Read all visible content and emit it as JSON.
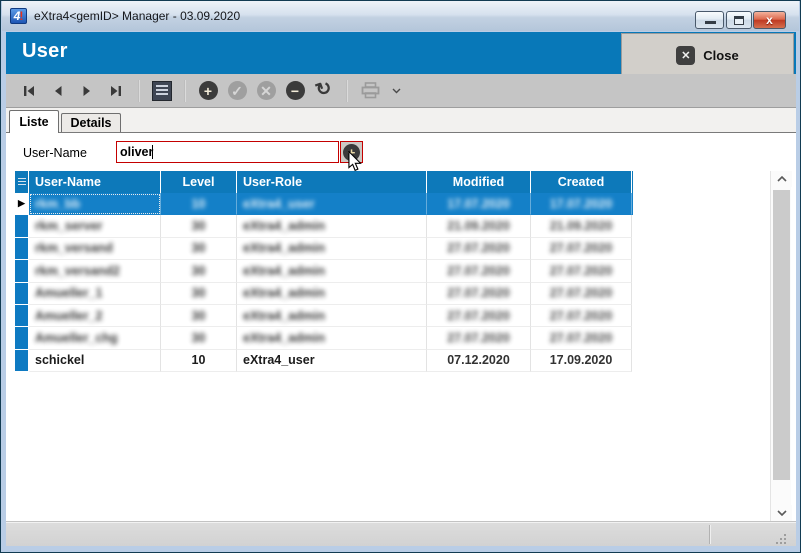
{
  "window": {
    "title": "eXtra4<gemID> Manager - 03.09.2020",
    "app_icon_text": "4",
    "app_icon_excl": "!",
    "controls": {
      "minimize": "minimize",
      "maximize": "maximize",
      "close": "close"
    }
  },
  "header": {
    "title": "User",
    "close_button": {
      "label": "Close",
      "glyph": "✕"
    }
  },
  "toolbar": {
    "items": [
      {
        "name": "first-record-button"
      },
      {
        "name": "prior-record-button"
      },
      {
        "name": "next-record-button"
      },
      {
        "name": "last-record-button"
      },
      {
        "name": "form-view-button"
      },
      {
        "name": "insert-record-button",
        "glyph": "+",
        "enabled": true
      },
      {
        "name": "confirm-button",
        "glyph": "✓",
        "enabled": false
      },
      {
        "name": "cancel-button",
        "glyph": "✕",
        "enabled": false
      },
      {
        "name": "delete-record-button",
        "glyph": "−",
        "enabled": true
      },
      {
        "name": "refresh-button",
        "glyph": "↻",
        "enabled": true
      },
      {
        "name": "print-button",
        "enabled": false
      },
      {
        "name": "print-dropdown-button"
      }
    ]
  },
  "tabs": [
    {
      "label": "Liste",
      "active": true
    },
    {
      "label": "Details",
      "active": false
    }
  ],
  "filter": {
    "label": "User-Name",
    "value": "oliver",
    "add_button_glyph": "+"
  },
  "table": {
    "columns": [
      "User-Name",
      "Level",
      "User-Role",
      "Modified",
      "Created"
    ],
    "rows": [
      {
        "user_name": "rkm_bb",
        "level": "10",
        "user_role": "eXtra4_user",
        "modified": "17.07.2020",
        "created": "17.07.2020",
        "selected": true,
        "blurred": true
      },
      {
        "user_name": "rkm_server",
        "level": "30",
        "user_role": "eXtra4_admin",
        "modified": "21.09.2020",
        "created": "21.09.2020",
        "selected": false,
        "blurred": true
      },
      {
        "user_name": "rkm_versand",
        "level": "30",
        "user_role": "eXtra4_admin",
        "modified": "27.07.2020",
        "created": "27.07.2020",
        "selected": false,
        "blurred": true
      },
      {
        "user_name": "rkm_versand2",
        "level": "30",
        "user_role": "eXtra4_admin",
        "modified": "27.07.2020",
        "created": "27.07.2020",
        "selected": false,
        "blurred": true
      },
      {
        "user_name": "Amueller_1",
        "level": "30",
        "user_role": "eXtra4_admin",
        "modified": "27.07.2020",
        "created": "27.07.2020",
        "selected": false,
        "blurred": true
      },
      {
        "user_name": "Amueller_2",
        "level": "30",
        "user_role": "eXtra4_admin",
        "modified": "27.07.2020",
        "created": "27.07.2020",
        "selected": false,
        "blurred": true
      },
      {
        "user_name": "Amueller_chg",
        "level": "30",
        "user_role": "eXtra4_admin",
        "modified": "27.07.2020",
        "created": "27.07.2020",
        "selected": false,
        "blurred": true
      },
      {
        "user_name": "schickel",
        "level": "10",
        "user_role": "eXtra4_user",
        "modified": "07.12.2020",
        "created": "17.09.2020",
        "selected": false,
        "blurred": false
      }
    ]
  },
  "colors": {
    "accent_blue": "#0878b8",
    "header_blue": "#0d79ba",
    "selection_blue": "#1480c8",
    "focus_red": "#c40000",
    "frame_blue": "#b9cde6"
  }
}
